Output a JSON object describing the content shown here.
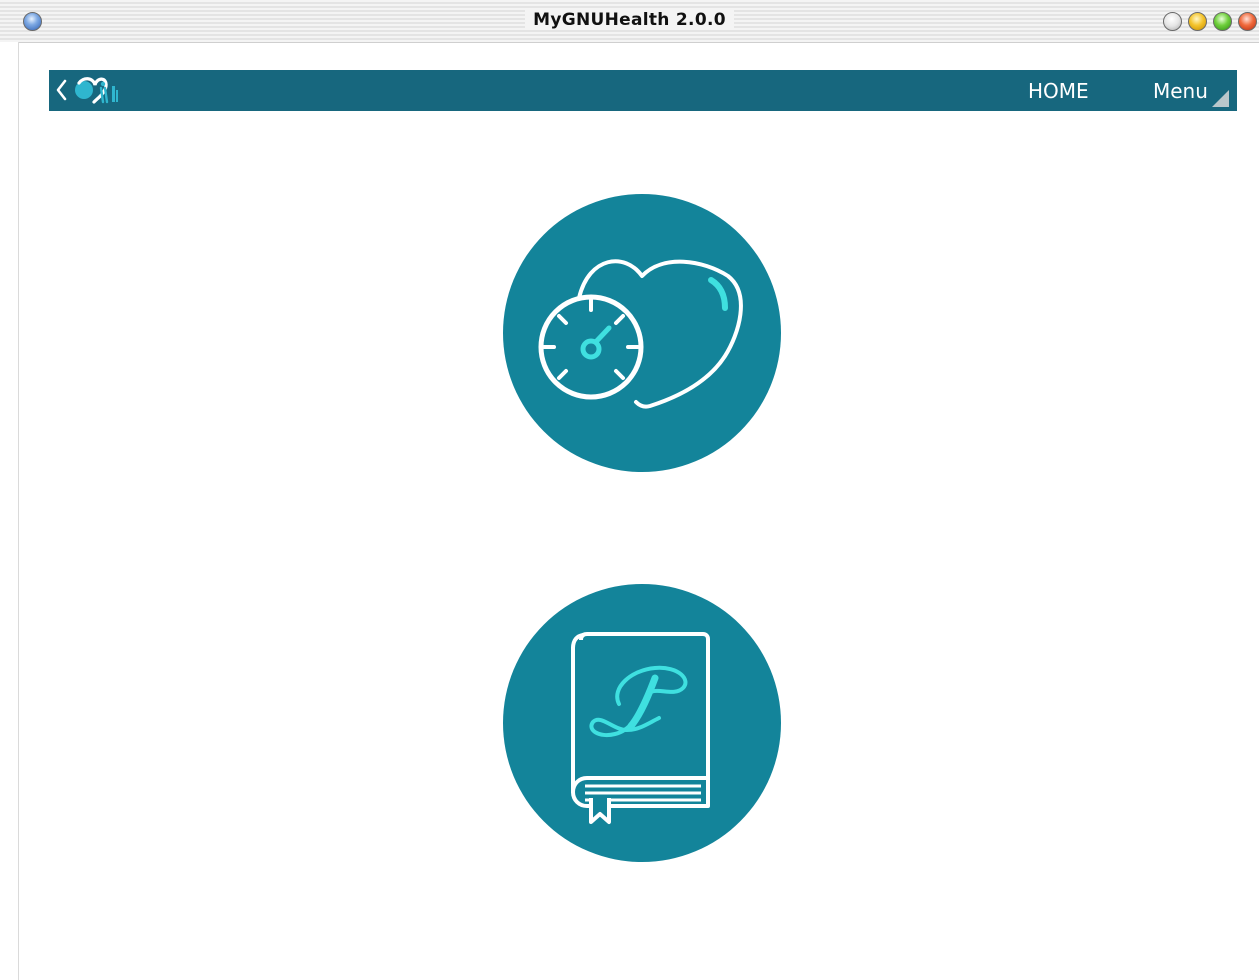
{
  "window": {
    "title": "MyGNUHealth 2.0.0"
  },
  "appbar": {
    "back_icon": "chevron-left-icon",
    "logo_icon": "mygnuhealth-logo-icon",
    "home_label": "HOME",
    "menu_label": "Menu"
  },
  "main": {
    "buttons": [
      {
        "name": "health-tracker-button",
        "icon": "heart-gauge-icon"
      },
      {
        "name": "book-of-life-button",
        "icon": "book-of-life-icon"
      }
    ]
  },
  "colors": {
    "appbar": "#17677e",
    "circle": "#13849a",
    "icon_stroke": "#ffffff",
    "icon_accent": "#3fe0e0"
  }
}
